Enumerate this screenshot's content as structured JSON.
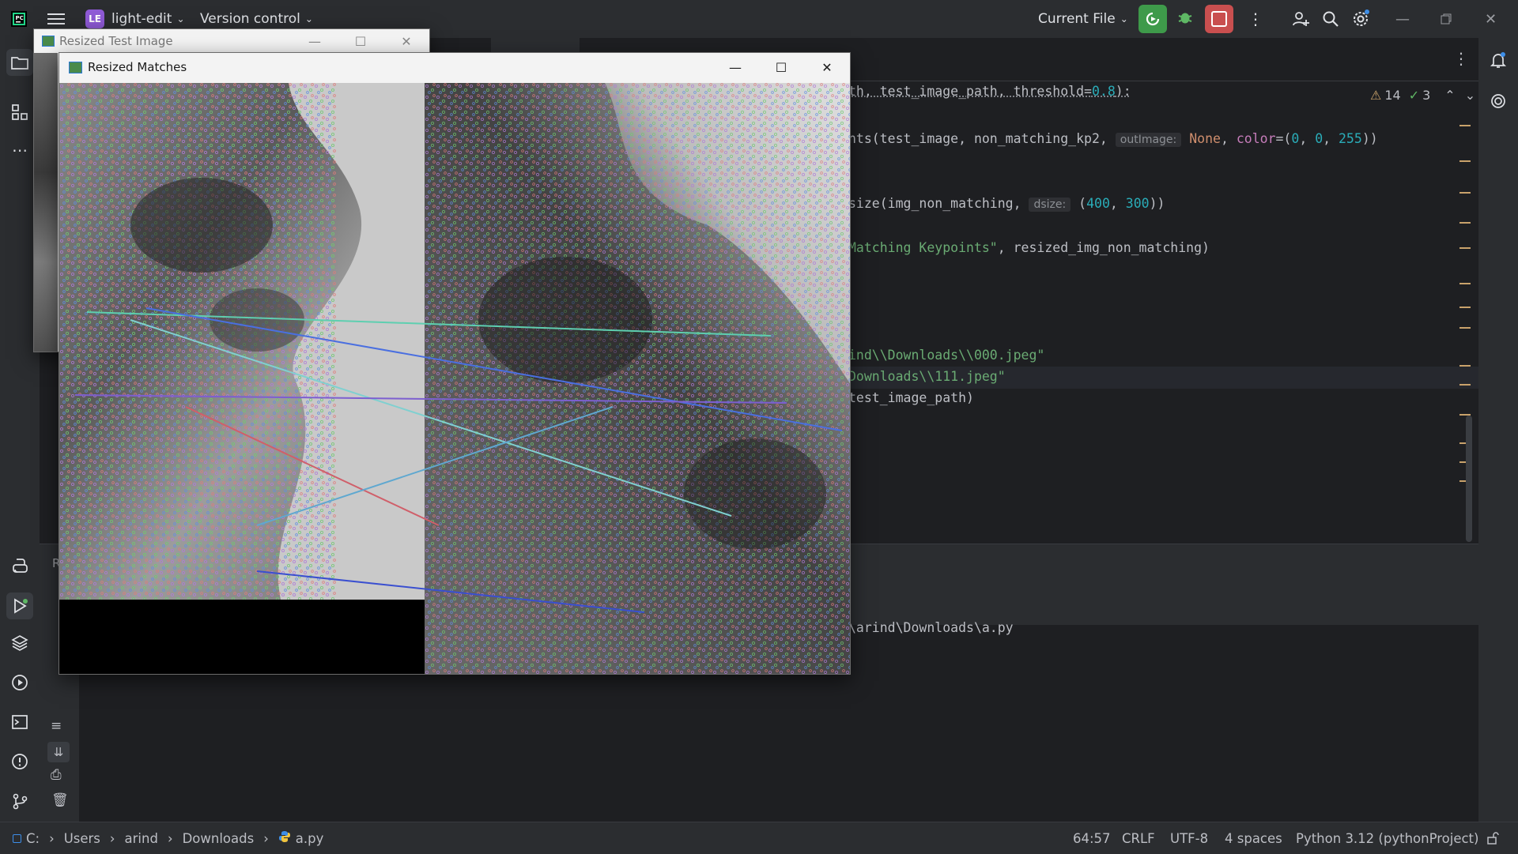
{
  "titlebar": {
    "project_badge": "LE",
    "project_name": "light-edit",
    "vcs": "Version control",
    "run_config": "Current File"
  },
  "editor": {
    "code": {
      "l1": "th, test_image_path, threshold=",
      "l1_num": "0.8",
      "l1_end": "):",
      "l2": "nts(test_image, non_matching_kp2, ",
      "l2_hint": "outImage:",
      "l2_none": "None",
      "l2_color": "color",
      "l2_eq": "=(",
      "l2_n1": "0",
      "l2_n2": "0",
      "l2_n3": "255",
      "l2_end": "))",
      "l3": "size(img_non_matching, ",
      "l3_hint": "dsize:",
      "l3_n1": "400",
      "l3_n2": "300",
      "l3_end": "))",
      "l4_str": "Matching Keypoints\"",
      "l4_end": ", resized_img_non_matching)",
      "l5_str": "ind\\\\Downloads\\\\000.jpeg\"",
      "l6_str": "Downloads\\\\111.jpeg\"",
      "l7": "test_image_path)"
    },
    "warnings_count": "14",
    "checks_count": "3"
  },
  "run": {
    "output_line": "\\arind\\Downloads\\a.py",
    "panel_label": "R"
  },
  "statusbar": {
    "breadcrumbs": [
      "C:",
      "Users",
      "arind",
      "Downloads",
      "a.py"
    ],
    "position": "64:57",
    "line_sep": "CRLF",
    "encoding": "UTF-8",
    "indent": "4 spaces",
    "interpreter": "Python 3.12 (pythonProject)"
  },
  "windows": {
    "test_image_title": "Resized Test Image",
    "matches_title": "Resized Matches"
  },
  "colors": {
    "accent_green": "#3e9a4a",
    "stop_red": "#c94f4f",
    "project_badge": "#8f5ad6"
  }
}
